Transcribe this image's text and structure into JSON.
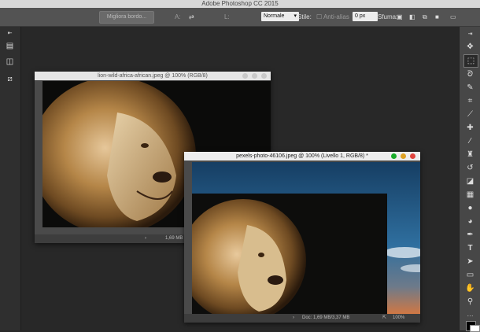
{
  "app": {
    "title": "Adobe Photoshop CC 2015"
  },
  "options": {
    "px_value": "0 px",
    "anti_alias": "Anti-alias",
    "style_label": "Stile:",
    "style_value": "Normale",
    "width_label": "L:",
    "height_label": "A:",
    "refine_edge": "Migliora bordo...",
    "feather_label": "Sfuma:"
  },
  "windows": [
    {
      "title": "lion-wild-africa-african.jpeg @ 100% (RGB/8)",
      "status": "1,69 MB"
    },
    {
      "title": "pexels-photo-46106.jpeg @ 100% (Livello 1, RGB/8) *",
      "status_zoom": "100%",
      "status_doc": "Doc: 1,69 MB/3,37 MB"
    }
  ],
  "colors": {
    "close": "#e0443e",
    "minimize": "#dea123",
    "zoom": "#1aab29",
    "sky_top": "#1d5a8a"
  }
}
